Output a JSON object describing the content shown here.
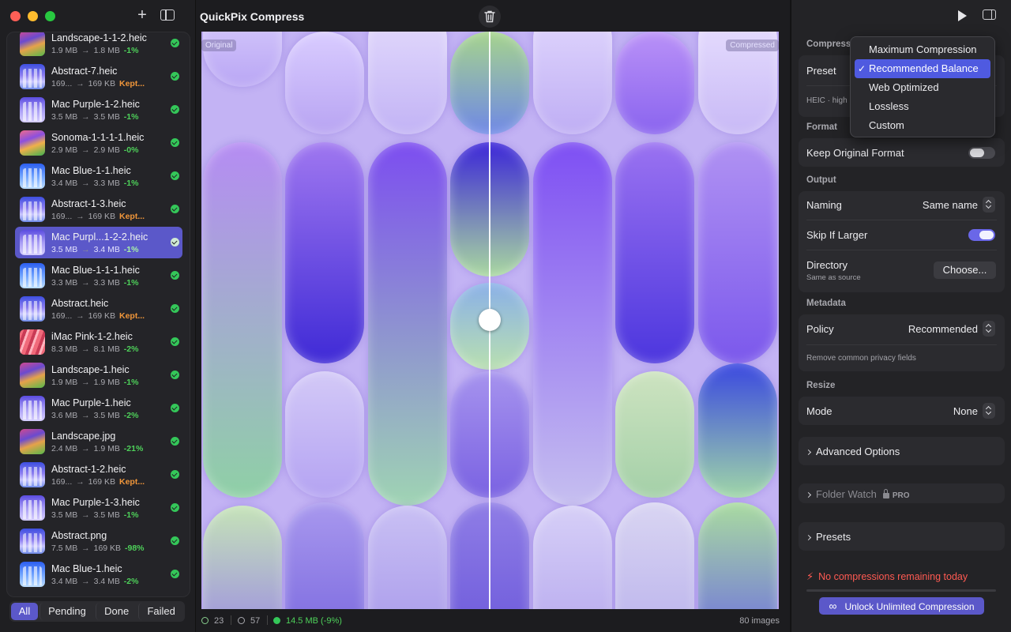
{
  "window": {
    "title": "QuickPix Compress"
  },
  "sidebar": {
    "add_label": "+",
    "files": [
      {
        "name": "Landscape-1-1-2.heic",
        "from": "1.9 MB",
        "to": "1.8 MB",
        "change": "-1%",
        "thumb": "landscape"
      },
      {
        "name": "Abstract-7.heic",
        "from": "169...",
        "to": "169 KB",
        "change": "Kept...",
        "thumb": "abstract"
      },
      {
        "name": "Mac Purple-1-2.heic",
        "from": "3.5 MB",
        "to": "3.5 MB",
        "change": "-1%",
        "thumb": "purple"
      },
      {
        "name": "Sonoma-1-1-1-1.heic",
        "from": "2.9 MB",
        "to": "2.9 MB",
        "change": "-0%",
        "thumb": "sonoma"
      },
      {
        "name": "Mac Blue-1-1.heic",
        "from": "3.4 MB",
        "to": "3.3 MB",
        "change": "-1%",
        "thumb": "blue"
      },
      {
        "name": "Abstract-1-3.heic",
        "from": "169...",
        "to": "169 KB",
        "change": "Kept...",
        "thumb": "abstract"
      },
      {
        "name": "Mac Purpl...1-2-2.heic",
        "from": "3.5 MB",
        "to": "3.4 MB",
        "change": "-1%",
        "thumb": "purple"
      },
      {
        "name": "Mac Blue-1-1-1.heic",
        "from": "3.3 MB",
        "to": "3.3 MB",
        "change": "-1%",
        "thumb": "blue"
      },
      {
        "name": "Abstract.heic",
        "from": "169...",
        "to": "169 KB",
        "change": "Kept...",
        "thumb": "abstract"
      },
      {
        "name": "iMac Pink-1-2.heic",
        "from": "8.3 MB",
        "to": "8.1 MB",
        "change": "-2%",
        "thumb": "pink"
      },
      {
        "name": "Landscape-1.heic",
        "from": "1.9 MB",
        "to": "1.9 MB",
        "change": "-1%",
        "thumb": "landscape"
      },
      {
        "name": "Mac Purple-1.heic",
        "from": "3.6 MB",
        "to": "3.5 MB",
        "change": "-2%",
        "thumb": "purple"
      },
      {
        "name": "Landscape.jpg",
        "from": "2.4 MB",
        "to": "1.9 MB",
        "change": "-21%",
        "thumb": "landscape"
      },
      {
        "name": "Abstract-1-2.heic",
        "from": "169...",
        "to": "169 KB",
        "change": "Kept...",
        "thumb": "abstract"
      },
      {
        "name": "Mac Purple-1-3.heic",
        "from": "3.5 MB",
        "to": "3.5 MB",
        "change": "-1%",
        "thumb": "purple"
      },
      {
        "name": "Abstract.png",
        "from": "7.5 MB",
        "to": "169 KB",
        "change": "-98%",
        "thumb": "abstract"
      },
      {
        "name": "Mac Blue-1.heic",
        "from": "3.4 MB",
        "to": "3.4 MB",
        "change": "-2%",
        "thumb": "blue"
      }
    ],
    "filters": [
      "All",
      "Pending",
      "Done",
      "Failed"
    ]
  },
  "preview": {
    "original_label": "Original",
    "compressed_label": "Compressed"
  },
  "status": {
    "done_count": "23",
    "pending_count": "57",
    "saved": "14.5 MB (-9%)",
    "total": "80 images"
  },
  "inspector": {
    "compression_label": "Compress",
    "preset_label": "Preset",
    "preset_sub": "HEIC · high",
    "format_section": "Format",
    "keep_format_label": "Keep Original Format",
    "output_section": "Output",
    "naming_label": "Naming",
    "naming_value": "Same name",
    "skip_larger_label": "Skip If Larger",
    "directory_label": "Directory",
    "directory_sub": "Same as source",
    "choose_label": "Choose...",
    "metadata_section": "Metadata",
    "policy_label": "Policy",
    "policy_value": "Recommended",
    "policy_sub": "Remove common privacy fields",
    "resize_section": "Resize",
    "mode_label": "Mode",
    "mode_value": "None",
    "advanced_label": "Advanced Options",
    "folder_watch_label": "Folder Watch",
    "pro_label": "PRO",
    "presets_label": "Presets",
    "limit_warning": "No compressions remaining today",
    "unlock_label": "Unlock Unlimited Compression"
  },
  "preset_menu": {
    "options": [
      "Maximum Compression",
      "Recommended Balance",
      "Web Optimized",
      "Lossless",
      "Custom"
    ],
    "selected_index": 1,
    "check": "✓"
  },
  "colors": {
    "accent": "#5b58c9",
    "success": "#34c759",
    "kept": "#f0963a",
    "warning": "#ff5a52"
  }
}
